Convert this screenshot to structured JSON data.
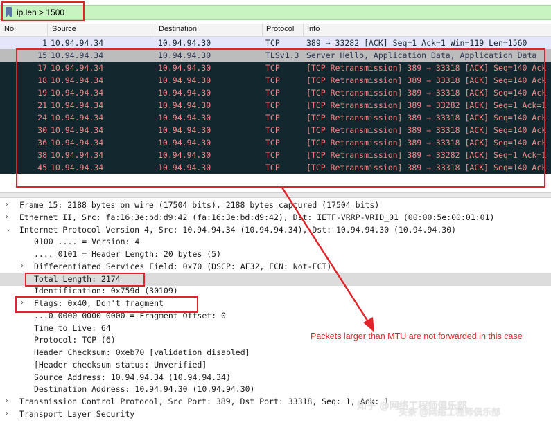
{
  "filter": {
    "icon": "bookmark-icon",
    "value": "ip.len > 1500"
  },
  "columns": {
    "no": "No.",
    "source": "Source",
    "destination": "Destination",
    "protocol": "Protocol",
    "info": "Info"
  },
  "packets": [
    {
      "no": "1",
      "source": "10.94.94.34",
      "destination": "10.94.94.30",
      "protocol": "TCP",
      "info": "389 → 33282 [ACK] Seq=1 Ack=1 Win=119 Len=1560",
      "style": "light"
    },
    {
      "no": "15",
      "source": "10.94.94.34",
      "destination": "10.94.94.30",
      "protocol": "TLSv1.3",
      "info": "Server Hello, Application Data, Application Data",
      "style": "selected"
    },
    {
      "no": "17",
      "source": "10.94.94.34",
      "destination": "10.94.94.30",
      "protocol": "TCP",
      "info": "[TCP Retransmission] 389 → 33318 [ACK] Seq=140 Ack",
      "style": "dark"
    },
    {
      "no": "18",
      "source": "10.94.94.34",
      "destination": "10.94.94.30",
      "protocol": "TCP",
      "info": "[TCP Retransmission] 389 → 33318 [ACK] Seq=140 Ack",
      "style": "dark"
    },
    {
      "no": "19",
      "source": "10.94.94.34",
      "destination": "10.94.94.30",
      "protocol": "TCP",
      "info": "[TCP Retransmission] 389 → 33318 [ACK] Seq=140 Ack",
      "style": "dark"
    },
    {
      "no": "21",
      "source": "10.94.94.34",
      "destination": "10.94.94.30",
      "protocol": "TCP",
      "info": "[TCP Retransmission] 389 → 33282 [ACK] Seq=1 Ack=1",
      "style": "dark"
    },
    {
      "no": "24",
      "source": "10.94.94.34",
      "destination": "10.94.94.30",
      "protocol": "TCP",
      "info": "[TCP Retransmission] 389 → 33318 [ACK] Seq=140 Ack",
      "style": "dark"
    },
    {
      "no": "30",
      "source": "10.94.94.34",
      "destination": "10.94.94.30",
      "protocol": "TCP",
      "info": "[TCP Retransmission] 389 → 33318 [ACK] Seq=140 Ack",
      "style": "dark"
    },
    {
      "no": "36",
      "source": "10.94.94.34",
      "destination": "10.94.94.30",
      "protocol": "TCP",
      "info": "[TCP Retransmission] 389 → 33318 [ACK] Seq=140 Ack",
      "style": "dark"
    },
    {
      "no": "38",
      "source": "10.94.94.34",
      "destination": "10.94.94.30",
      "protocol": "TCP",
      "info": "[TCP Retransmission] 389 → 33282 [ACK] Seq=1 Ack=1",
      "style": "dark"
    },
    {
      "no": "45",
      "source": "10.94.94.34",
      "destination": "10.94.94.30",
      "protocol": "TCP",
      "info": "[TCP Retransmission] 389 → 33318 [ACK] Seq=140 Ack",
      "style": "dark"
    }
  ],
  "details": [
    {
      "indent": 0,
      "twisty": "collapsed",
      "text": "Frame 15: 2188 bytes on wire (17504 bits), 2188 bytes captured (17504 bits)"
    },
    {
      "indent": 0,
      "twisty": "collapsed",
      "text": "Ethernet II, Src: fa:16:3e:bd:d9:42 (fa:16:3e:bd:d9:42), Dst: IETF-VRRP-VRID_01 (00:00:5e:00:01:01)"
    },
    {
      "indent": 0,
      "twisty": "expanded",
      "text": "Internet Protocol Version 4, Src: 10.94.94.34 (10.94.94.34), Dst: 10.94.94.30 (10.94.94.30)"
    },
    {
      "indent": 1,
      "twisty": "none",
      "text": "0100 .... = Version: 4"
    },
    {
      "indent": 1,
      "twisty": "none",
      "text": ".... 0101 = Header Length: 20 bytes (5)"
    },
    {
      "indent": 1,
      "twisty": "collapsed",
      "text": "Differentiated Services Field: 0x70 (DSCP: AF32, ECN: Not-ECT)"
    },
    {
      "indent": 1,
      "twisty": "none",
      "text": "Total Length: 2174",
      "highlight": true
    },
    {
      "indent": 1,
      "twisty": "none",
      "text": "Identification: 0x759d (30109)"
    },
    {
      "indent": 1,
      "twisty": "collapsed",
      "text": "Flags: 0x40, Don't fragment"
    },
    {
      "indent": 1,
      "twisty": "none",
      "text": "...0 0000 0000 0000 = Fragment Offset: 0"
    },
    {
      "indent": 1,
      "twisty": "none",
      "text": "Time to Live: 64"
    },
    {
      "indent": 1,
      "twisty": "none",
      "text": "Protocol: TCP (6)"
    },
    {
      "indent": 1,
      "twisty": "none",
      "text": "Header Checksum: 0xeb70 [validation disabled]"
    },
    {
      "indent": 1,
      "twisty": "none",
      "text": "[Header checksum status: Unverified]"
    },
    {
      "indent": 1,
      "twisty": "none",
      "text": "Source Address: 10.94.94.34 (10.94.94.34)"
    },
    {
      "indent": 1,
      "twisty": "none",
      "text": "Destination Address: 10.94.94.30 (10.94.94.30)"
    },
    {
      "indent": 0,
      "twisty": "collapsed",
      "text": "Transmission Control Protocol, Src Port: 389, Dst Port: 33318, Seq: 1, Ack: 1"
    },
    {
      "indent": 0,
      "twisty": "collapsed",
      "text": "Transport Layer Security"
    }
  ],
  "annotation": {
    "text": "Packets larger than MTU are not forwarded in this case",
    "color": "#e0242a"
  },
  "watermark": {
    "line1": "知乎 @网络工程师俱乐部",
    "line2": "头条 @网络工程师俱乐部"
  },
  "colors": {
    "filter_bg": "#c7f4c0",
    "dark_row_bg": "#12272e",
    "dark_row_fg": "#f78787",
    "light_row_bg": "#e6e6fa",
    "selected_bg": "#bcbcbc"
  }
}
